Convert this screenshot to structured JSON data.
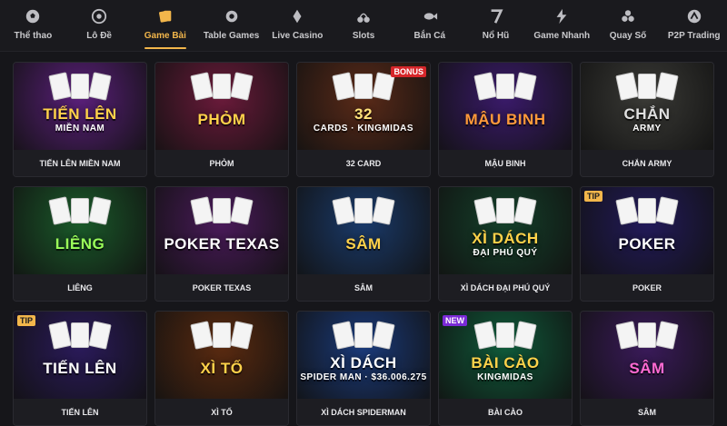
{
  "nav": {
    "items": [
      {
        "label": "Thể thao",
        "icon": "soccer-ball-icon",
        "active": false
      },
      {
        "label": "Lô Đề",
        "icon": "lottery-wheel-icon",
        "active": false
      },
      {
        "label": "Game Bài",
        "icon": "cards-icon",
        "active": true
      },
      {
        "label": "Table Games",
        "icon": "chips-icon",
        "active": false
      },
      {
        "label": "Live Casino",
        "icon": "diamond-suits-icon",
        "active": false
      },
      {
        "label": "Slots",
        "icon": "cherry-icon",
        "active": false
      },
      {
        "label": "Bắn Cá",
        "icon": "fish-icon",
        "active": false
      },
      {
        "label": "Nổ Hũ",
        "icon": "seven-icon",
        "active": false
      },
      {
        "label": "Game Nhanh",
        "icon": "lightning-icon",
        "active": false
      },
      {
        "label": "Quay Số",
        "icon": "balls-icon",
        "active": false
      },
      {
        "label": "P2P Trading",
        "icon": "p2p-icon",
        "active": false
      }
    ],
    "active_color": "#f2b64b"
  },
  "games": [
    {
      "title": "TIẾN LÊN MIỀN NAM",
      "logo": "TIẾN LÊN",
      "logo_sub": "MIỀN NAM",
      "bg": "#5a1f7a",
      "badge": "",
      "logo_color": "#ffd24a"
    },
    {
      "title": "PHỎM",
      "logo": "PHỎM",
      "logo_sub": "",
      "bg": "#6a1a3a",
      "badge": "",
      "logo_color": "#ffd24a"
    },
    {
      "title": "32 CARD",
      "logo": "32",
      "logo_sub": "CARDS · KINGMIDAS",
      "bg": "#5a2a18",
      "badge": "BONUS",
      "logo_color": "#ffe27a"
    },
    {
      "title": "MẬU BINH",
      "logo": "MẬU BINH",
      "logo_sub": "",
      "bg": "#3a1a6a",
      "badge": "",
      "logo_color": "#ff9a3a"
    },
    {
      "title": "CHẮN ARMY",
      "logo": "CHẮN",
      "logo_sub": "ARMY",
      "bg": "#3a3a36",
      "badge": "",
      "logo_color": "#e0e0e0"
    },
    {
      "title": "LIÊNG",
      "logo": "LIÊNG",
      "logo_sub": "",
      "bg": "#1a5a2a",
      "badge": "",
      "logo_color": "#9bff5a"
    },
    {
      "title": "POKER TEXAS",
      "logo": "POKER TEXAS",
      "logo_sub": "",
      "bg": "#4a1a5a",
      "badge": "",
      "logo_color": "#ffffff"
    },
    {
      "title": "SÂM",
      "logo": "SÂM",
      "logo_sub": "",
      "bg": "#1a3a6a",
      "badge": "",
      "logo_color": "#ffd24a"
    },
    {
      "title": "XÌ DÁCH ĐẠI PHÚ QUÝ",
      "logo": "XÌ DÁCH",
      "logo_sub": "ĐẠI PHÚ QUÝ",
      "bg": "#14402a",
      "badge": "",
      "logo_color": "#ffd24a"
    },
    {
      "title": "POKER",
      "logo": "POKER",
      "logo_sub": "",
      "bg": "#221a5a",
      "badge": "TIP",
      "logo_color": "#ffffff"
    },
    {
      "title": "TIẾN LÊN",
      "logo": "TIẾN LÊN",
      "logo_sub": "",
      "bg": "#2a1a5a",
      "badge": "TIP",
      "logo_color": "#ffffff"
    },
    {
      "title": "XÌ TỐ",
      "logo": "XÌ TỐ",
      "logo_sub": "",
      "bg": "#5a2a10",
      "badge": "",
      "logo_color": "#ffd24a"
    },
    {
      "title": "XÌ DÁCH SPIDERMAN",
      "logo": "XÌ DÁCH",
      "logo_sub": "SPIDER MAN · $36.006.275",
      "bg": "#1a3a7a",
      "badge": "",
      "logo_color": "#ffffff"
    },
    {
      "title": "BÀI CÀO",
      "logo": "BÀI CÀO",
      "logo_sub": "KINGMIDAS",
      "bg": "#0f5a3a",
      "badge": "NEW",
      "logo_color": "#ffd24a"
    },
    {
      "title": "SÂM",
      "logo": "SÂM",
      "logo_sub": "",
      "bg": "#3a1a5a",
      "badge": "",
      "logo_color": "#ff6ad2"
    }
  ]
}
